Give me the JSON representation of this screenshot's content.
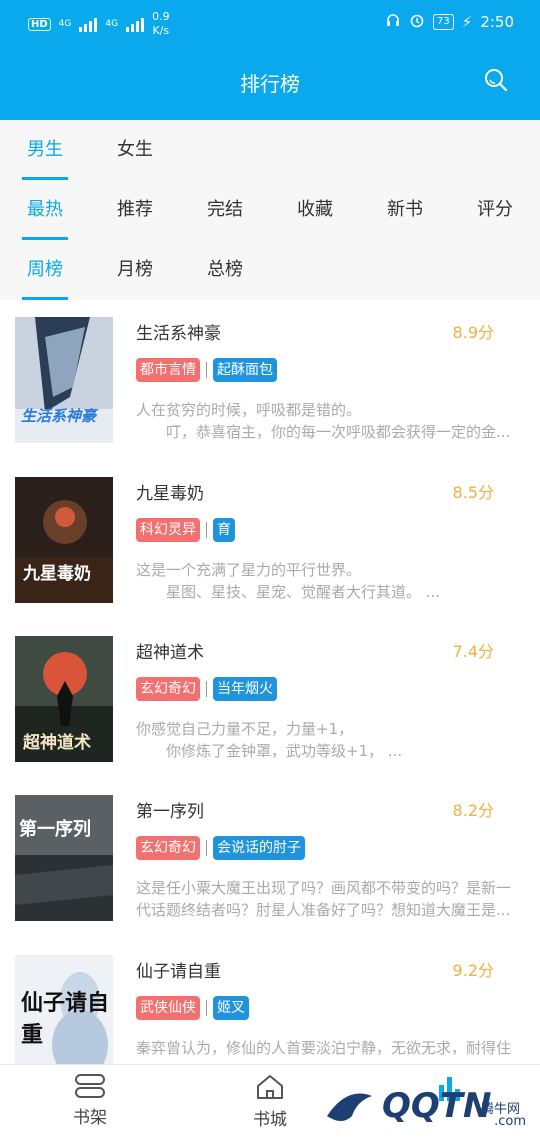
{
  "status": {
    "hd": "HD",
    "net1": "4G",
    "net2": "4G",
    "speed_value": "0.9",
    "speed_unit": "K/s",
    "battery": "73",
    "time": "2:50"
  },
  "header": {
    "title": "排行榜"
  },
  "gender_tabs": [
    "男生",
    "女生"
  ],
  "category_tabs": [
    "最热",
    "推荐",
    "完结",
    "收藏",
    "新书",
    "评分"
  ],
  "period_tabs": [
    "周榜",
    "月榜",
    "总榜"
  ],
  "books": [
    {
      "title": "生活系神豪",
      "score": "8.9分",
      "tag1": "都市言情",
      "tag2": "起酥面包",
      "desc1": "人在贫穷的时候，呼吸都是错的。",
      "desc2": "叮，恭喜宿主，你的每一次呼吸都会获得一定的金...",
      "cover_text": "生活系神豪"
    },
    {
      "title": "九星毒奶",
      "score": "8.5分",
      "tag1": "科幻灵异",
      "tag2": "育",
      "desc1": "这是一个充满了星力的平行世界。",
      "desc2": "星图、星技、星宠、觉醒者大行其道。 ...",
      "cover_text": "九星毒奶"
    },
    {
      "title": "超神道术",
      "score": "7.4分",
      "tag1": "玄幻奇幻",
      "tag2": "当年烟火",
      "desc1": "你感觉自己力量不足，力量+1，",
      "desc2": "你修炼了金钟罩，武功等级+1，  ...",
      "cover_text": "超神道术"
    },
    {
      "title": "第一序列",
      "score": "8.2分",
      "tag1": "玄幻奇幻",
      "tag2": "会说话的肘子",
      "desc1": "这是任小粟大魔王出现了吗？画风都不带变的吗？是新一",
      "desc2": "代话题终结者吗？肘星人准备好了吗？想知道大魔王是...",
      "cover_text": "第一序列"
    },
    {
      "title": "仙子请自重",
      "score": "9.2分",
      "tag1": "武侠仙侠",
      "tag2": "姬叉",
      "desc1": "秦弈曾认为，修仙的人首要淡泊宁静，无欲无求，耐得住",
      "desc2": "",
      "cover_text": "仙子请自重"
    }
  ],
  "bottom_nav": [
    "书架",
    "书城"
  ],
  "watermark": {
    "brand": "QQTN",
    "site": "腾牛网",
    "com": ".com"
  }
}
